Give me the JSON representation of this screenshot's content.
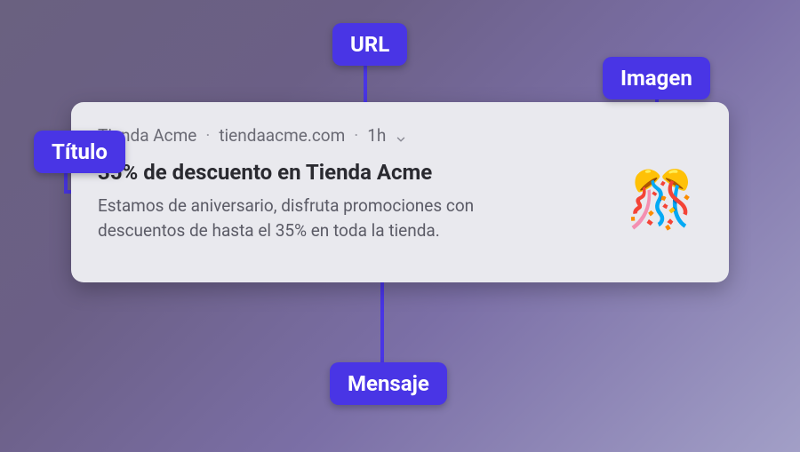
{
  "labels": {
    "url": "URL",
    "imagen": "Imagen",
    "titulo": "Título",
    "mensaje": "Mensaje"
  },
  "notification": {
    "app_name": "Tienda Acme",
    "url": "tiendaacme.com",
    "time": "1h",
    "title": "35% de descuento en Tienda Acme",
    "message": "Estamos de aniversario, disfruta promociones con descuentos de hasta el 35% en toda la tienda.",
    "image_glyph": "🎊"
  },
  "colors": {
    "pill_bg": "#4935e5",
    "card_bg": "#e9e9ee"
  }
}
